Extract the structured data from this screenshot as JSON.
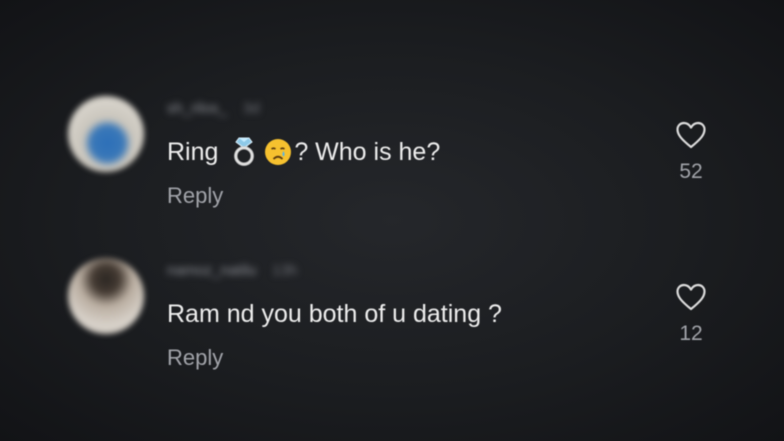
{
  "comments": [
    {
      "username": "sh_rilos_",
      "time": "3d",
      "text_before": "Ring",
      "emojis": [
        "ring-emoji",
        "crying-face-emoji"
      ],
      "text_after": "? Who is he?",
      "reply_label": "Reply",
      "like_count": "52"
    },
    {
      "username": "namoz_natilu",
      "time": "13h",
      "text": "Ram nd you both of u dating ?",
      "reply_label": "Reply",
      "like_count": "12"
    }
  ],
  "colors": {
    "background": "#1b1d20",
    "text": "#eeeeee",
    "secondary_text": "#a2a4aa"
  }
}
